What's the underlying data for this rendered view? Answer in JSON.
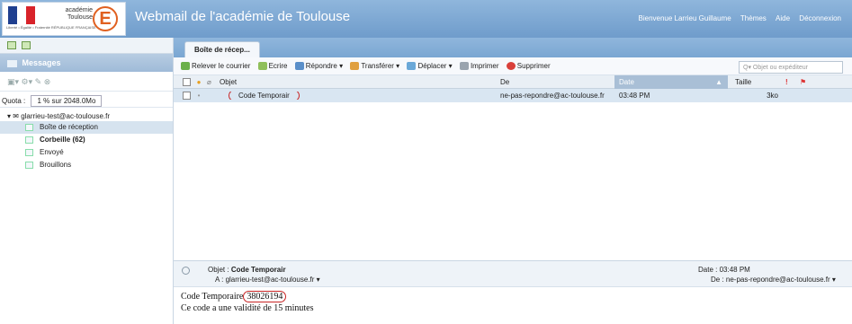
{
  "header": {
    "flag_text": "Liberté • Égalité • Fraternité RÉPUBLIQUE FRANÇAISE",
    "academy_line1": "académie",
    "academy_line2": "Toulouse",
    "logo_letter": "E",
    "app_title": "Webmail de l'académie de Toulouse",
    "welcome": "Bienvenue Larrieu Guillaume",
    "themes": "Thèmes",
    "help": "Aide",
    "logout": "Déconnexion"
  },
  "left": {
    "section_title": "Messages",
    "quota_label": "Quota :",
    "quota_value": "1 % sur 2048.0Mo",
    "account": "glarrieu-test@ac-toulouse.fr",
    "folders": [
      {
        "label": "Boîte de réception",
        "selected": true
      },
      {
        "label": "Corbeille (62)",
        "bold": true
      },
      {
        "label": "Envoyé"
      },
      {
        "label": "Brouillons"
      }
    ]
  },
  "main": {
    "tab_label": "Boîte de récep...",
    "toolbar": {
      "relever": "Relever le courrier",
      "ecrire": "Ecrire",
      "repondre": "Répondre",
      "transferer": "Transférer",
      "deplacer": "Déplacer",
      "imprimer": "Imprimer",
      "supprimer": "Supprimer"
    },
    "search_placeholder": "Objet ou expéditeur",
    "columns": {
      "objet": "Objet",
      "de": "De",
      "date": "Date",
      "taille": "Taille",
      "sort_indicator": "▲"
    },
    "messages": [
      {
        "objet": "Code Temporair",
        "de": "ne-pas-repondre@ac-toulouse.fr",
        "date": "03:48 PM",
        "taille": "3ko"
      }
    ]
  },
  "preview": {
    "objet_label": "Objet :",
    "objet_value": "Code Temporair",
    "a_label": "A :",
    "a_value": "glarrieu-test@ac-toulouse.fr ▾",
    "date_label": "Date :",
    "date_value": "03:48 PM",
    "de_label": "De :",
    "de_value": "ne-pas-repondre@ac-toulouse.fr ▾",
    "body_prefix": "Code Temporaire",
    "body_code": "38026194",
    "body_line2": "Ce code a une validité de 15 minutes"
  },
  "colors": {
    "header_blue": "#7aa6d2",
    "selection_blue": "#d9e6f2",
    "highlight_red": "#c82424",
    "logo_orange": "#e06020"
  }
}
